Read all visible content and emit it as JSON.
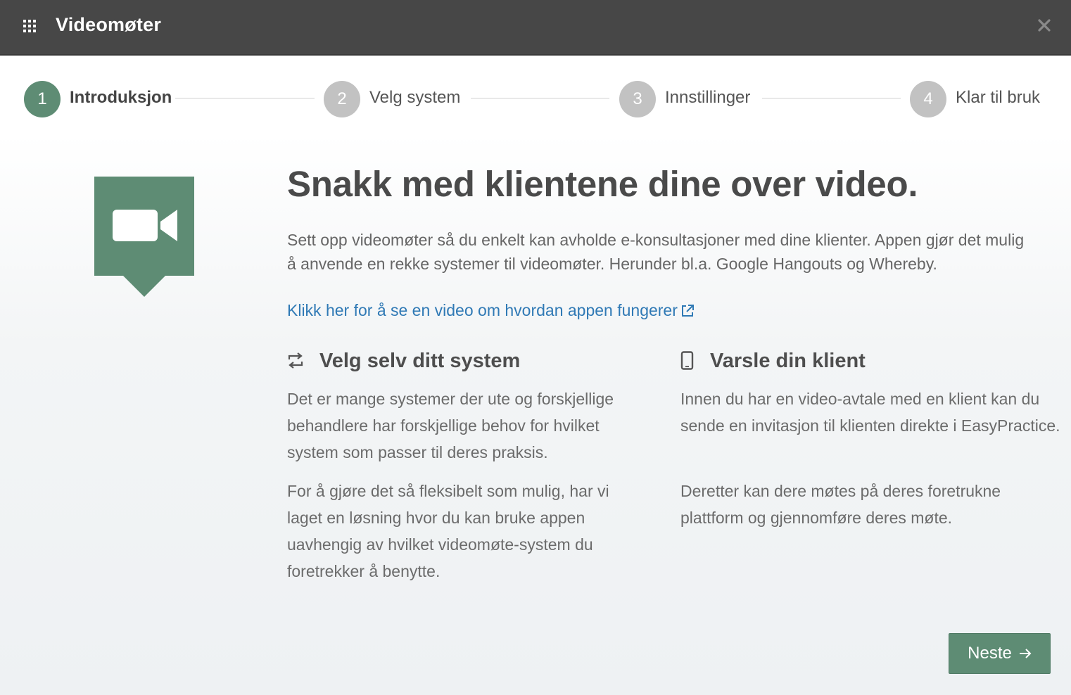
{
  "header": {
    "title": "Videomøter",
    "apps_icon": "apps-grid-icon",
    "close_icon": "close-icon"
  },
  "steps": [
    {
      "number": "1",
      "label": "Introduksjon",
      "active": true
    },
    {
      "number": "2",
      "label": "Velg system",
      "active": false
    },
    {
      "number": "3",
      "label": "Innstillinger",
      "active": false
    },
    {
      "number": "4",
      "label": "Klar til bruk",
      "active": false
    }
  ],
  "main": {
    "badge_icon": "video-camera-icon",
    "headline": "Snakk med klientene dine over video.",
    "intro": "Sett opp videomøter så du enkelt kan avholde e-konsultasjoner med dine klienter. Appen gjør det mulig å anvende en rekke systemer til videomøter. Herunder bl.a. Google Hangouts og Whereby.",
    "video_link": "Klikk her for å se en video om hvordan appen fungerer",
    "video_link_icon": "external-link-icon"
  },
  "features": [
    {
      "icon": "repeat-arrows-icon",
      "heading": "Velg selv ditt system",
      "paragraphs": [
        "Det er mange systemer der ute og forskjellige behandlere har forskjellige behov for hvilket system som passer til deres praksis.",
        "For å gjøre det så fleksibelt som mulig, har vi laget en løsning hvor du kan bruke appen uavhengig av hvilket videomøte-system du foretrekker å benytte."
      ]
    },
    {
      "icon": "mobile-phone-icon",
      "heading": "Varsle din klient",
      "paragraphs": [
        "Innen du har en video-avtale med en klient kan du sende en invitasjon til klienten direkte i EasyPractice.",
        "Deretter kan dere møtes på deres foretrukne plattform og gjennomføre deres møte."
      ]
    }
  ],
  "footer": {
    "next_label": "Neste",
    "next_icon": "arrow-right-icon"
  },
  "colors": {
    "header_bg": "#474747",
    "accent_green": "#5e8c74",
    "link_blue": "#2f79b5",
    "inactive_step": "#c2c2c2"
  }
}
